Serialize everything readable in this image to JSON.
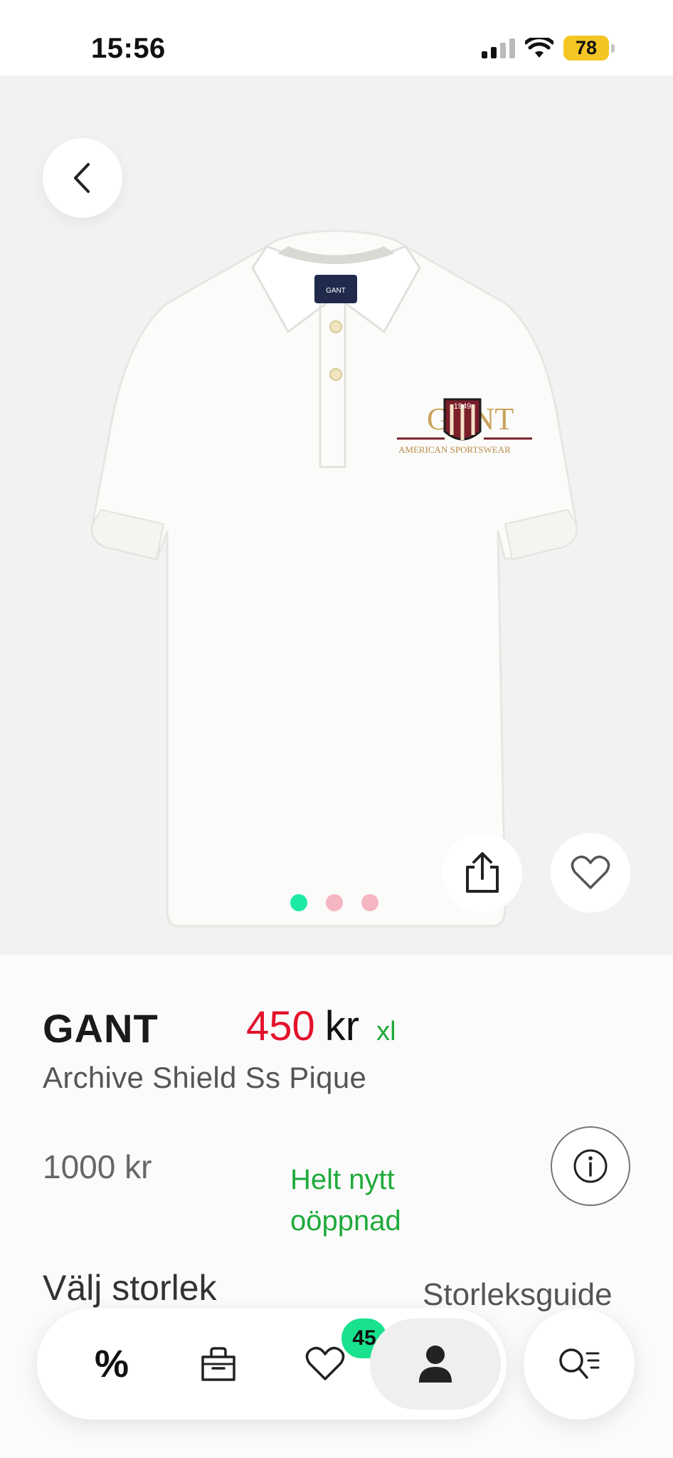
{
  "status_bar": {
    "time": "15:56",
    "battery": "78"
  },
  "hero": {
    "image_count": 3,
    "active_image": 1,
    "colors": {
      "dot_active": "#1de9a6",
      "dot_inactive": "#f5b6c2",
      "background": "#f2f2f2"
    },
    "shirt_label": "GANT",
    "logo_year": "1949",
    "logo_text": "GANT",
    "logo_subtext": "AMERICAN SPORTSWEAR"
  },
  "product": {
    "brand": "GANT",
    "price_amount": "450",
    "price_currency": "kr",
    "size_tag": "xl",
    "name": "Archive Shield Ss Pique",
    "original_price": "1000 kr",
    "condition_line1": "Helt nytt",
    "condition_line2": "oöppnad",
    "choose_size": "Välj storlek",
    "size_guide": "Storleksguide"
  },
  "nav": {
    "discount_label": "%",
    "favorites_count": "45"
  },
  "icons": [
    "back-arrow-icon",
    "share-icon",
    "heart-icon",
    "info-icon",
    "percent-icon",
    "bag-icon",
    "heart-icon",
    "user-icon",
    "search-list-icon"
  ],
  "colors": {
    "price": "#e3122b",
    "accent_green": "#1faa3a",
    "badge": "#19e28f"
  }
}
